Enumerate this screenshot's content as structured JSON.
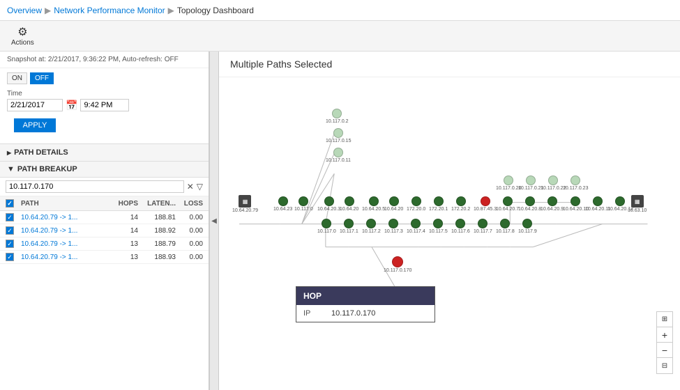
{
  "breadcrumb": {
    "overview": "Overview",
    "monitor": "Network Performance Monitor",
    "dashboard": "Topology Dashboard"
  },
  "toolbar": {
    "actions_label": "Actions",
    "actions_icon": "⚙"
  },
  "left_panel": {
    "snapshot_text": "Snapshot at: 2/21/2017, 9:36:22 PM, Auto-refresh: OFF",
    "toggle_on": "ON",
    "toggle_off": "OFF",
    "time_label": "Time",
    "date_value": "2/21/2017",
    "time_value": "9:42 PM",
    "apply_label": "APPLY",
    "path_details_label": "PATH DETAILS",
    "path_breakup_label": "PATH BREAKUP",
    "filter_value": "10.117.0.170",
    "table_headers": {
      "path": "PATH",
      "hops": "HOPS",
      "latency": "LATEN...",
      "loss": "LOSS"
    },
    "paths": [
      {
        "path": "10.64.20.79 -> 1...",
        "hops": "14",
        "latency": "188.81",
        "loss": "0.00",
        "checked": true
      },
      {
        "path": "10.64.20.79 -> 1...",
        "hops": "14",
        "latency": "188.92",
        "loss": "0.00",
        "checked": true
      },
      {
        "path": "10.64.20.79 -> 1...",
        "hops": "13",
        "latency": "188.79",
        "loss": "0.00",
        "checked": true
      },
      {
        "path": "10.64.20.79 -> 1...",
        "hops": "13",
        "latency": "188.93",
        "loss": "0.00",
        "checked": true
      }
    ]
  },
  "right_panel": {
    "title": "Multiple Paths Selected",
    "hop_tooltip": {
      "header": "HOP",
      "ip_label": "IP",
      "ip_value": "10.117.0.170"
    }
  },
  "zoom_controls": {
    "plus": "+",
    "minus": "−",
    "fit": "⊞",
    "grid": "⊟"
  }
}
